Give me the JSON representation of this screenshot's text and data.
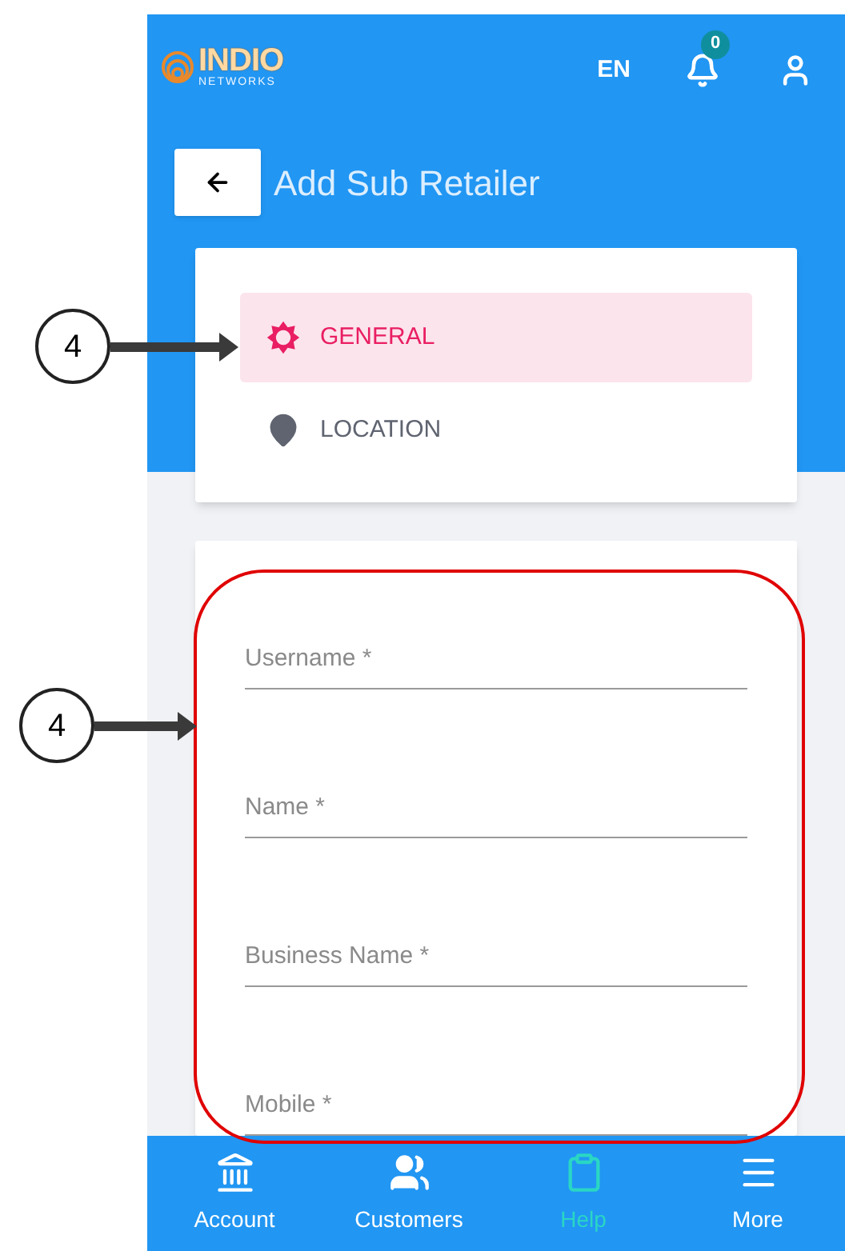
{
  "header": {
    "logo": {
      "name": "INDIO",
      "tagline": "NETWORKS"
    },
    "language": "EN",
    "notification_count": "0"
  },
  "page_title": "Add Sub Retailer",
  "tabs": [
    {
      "label": "GENERAL",
      "kind": "general",
      "selected": true
    },
    {
      "label": "LOCATION",
      "kind": "location",
      "selected": false
    }
  ],
  "form": {
    "fields": [
      {
        "placeholder": "Username *"
      },
      {
        "placeholder": "Name *"
      },
      {
        "placeholder": "Business Name *"
      },
      {
        "placeholder": "Mobile *"
      }
    ]
  },
  "bottom_nav": [
    {
      "label": "Account",
      "kind": "account",
      "selected": false
    },
    {
      "label": "Customers",
      "kind": "customers",
      "selected": false
    },
    {
      "label": "Help",
      "kind": "help",
      "selected": true
    },
    {
      "label": "More",
      "kind": "more",
      "selected": false
    }
  ],
  "annotations": [
    {
      "label": "4"
    },
    {
      "label": "4"
    }
  ]
}
